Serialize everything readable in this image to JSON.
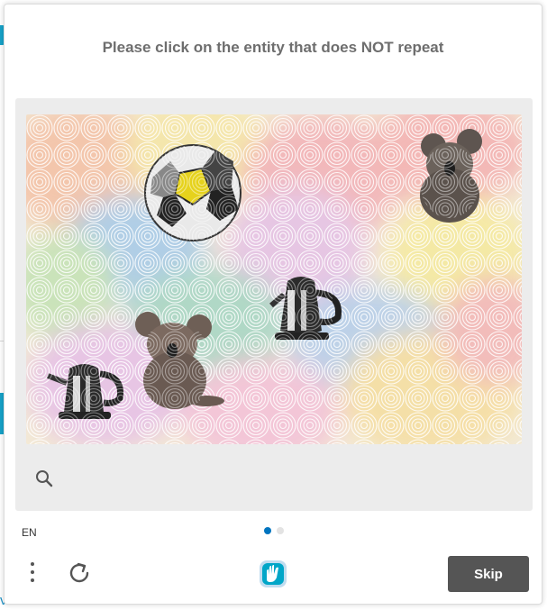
{
  "captcha": {
    "prompt": "Please click on the entity that does NOT repeat",
    "language": "EN",
    "skip_label": "Skip",
    "pagination": {
      "total": 2,
      "current": 1
    },
    "accent_color": "#0074bf",
    "image_items": [
      "soccer-ball",
      "koala",
      "kettle",
      "koala",
      "kettle"
    ]
  },
  "background_page": {
    "footer_fragment": "ver  </> API"
  }
}
